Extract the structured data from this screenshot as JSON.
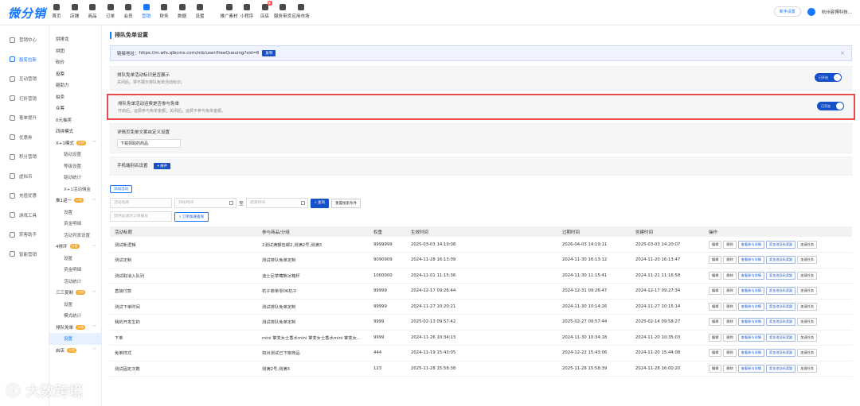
{
  "brand": {
    "logo": "微分销",
    "accent": "#1677ff",
    "dark_blue": "#1650c8",
    "highlight_border": "#e74c4c"
  },
  "topnav": [
    {
      "label": "首页",
      "icon": "home-icon"
    },
    {
      "label": "店铺",
      "icon": "store-icon"
    },
    {
      "label": "商品",
      "icon": "goods-icon"
    },
    {
      "label": "订单",
      "icon": "order-icon"
    },
    {
      "label": "会员",
      "icon": "member-icon"
    },
    {
      "label": "营销",
      "icon": "marketing-icon",
      "active": true
    },
    {
      "label": "财务",
      "icon": "finance-icon"
    },
    {
      "label": "数据",
      "icon": "data-icon"
    },
    {
      "label": "设置",
      "icon": "settings-icon"
    },
    {
      "label": "推广素材",
      "icon": "share-icon"
    },
    {
      "label": "小程序",
      "icon": "miniapp-icon"
    },
    {
      "label": "店店",
      "icon": "shop-icon",
      "tag": "新"
    },
    {
      "label": "服务带货",
      "icon": "service-icon"
    },
    {
      "label": "应用市场",
      "icon": "app-market-icon"
    }
  ],
  "top_right": {
    "pill": "新手设置",
    "company": "杭州容博科技..."
  },
  "sidebar1": [
    {
      "label": "营销中心"
    },
    {
      "label": "裂变拉新",
      "active": true
    },
    {
      "label": "互动营销"
    },
    {
      "label": "打折营销"
    },
    {
      "label": "客单提升"
    },
    {
      "label": "优惠券"
    },
    {
      "label": "积分营销"
    },
    {
      "label": "虚拟币"
    },
    {
      "label": "充值优惠"
    },
    {
      "label": "游戏工具"
    },
    {
      "label": "获客助手"
    },
    {
      "label": "智能营销"
    }
  ],
  "sidebar2": [
    {
      "label": "拼排龙"
    },
    {
      "label": "拼团"
    },
    {
      "label": "砍价"
    },
    {
      "label": "投票"
    },
    {
      "label": "砸助力"
    },
    {
      "label": "拍卖"
    },
    {
      "label": "众筹"
    },
    {
      "label": "0元抽奖"
    },
    {
      "label": "四拼模式"
    },
    {
      "label": "X+1模式",
      "badge": "分销",
      "chev": "﹀"
    },
    {
      "label": "链动设置",
      "sub": true
    },
    {
      "label": "等级设置",
      "sub": true
    },
    {
      "label": "链动统计",
      "sub": true
    },
    {
      "label": "X+1活动佣金",
      "sub": true
    },
    {
      "label": "推1返一",
      "badge": "分销",
      "chev": "﹀"
    },
    {
      "label": "设置",
      "sub": true
    },
    {
      "label": "资金明细",
      "sub": true
    },
    {
      "label": "活动列表设置",
      "sub": true
    },
    {
      "label": "4排环",
      "badge": "分销",
      "chev": "﹀"
    },
    {
      "label": "设置",
      "sub": true
    },
    {
      "label": "资金明细",
      "sub": true
    },
    {
      "label": "活动统计",
      "sub": true
    },
    {
      "label": "三三复制",
      "badge": "分销",
      "chev": "﹀"
    },
    {
      "label": "设置",
      "sub": true
    },
    {
      "label": "模式统计",
      "sub": true
    },
    {
      "label": "排队免单",
      "badge": "分销",
      "chev": "﹀"
    },
    {
      "label": "设置",
      "sub": true,
      "active": true
    },
    {
      "label": "启店",
      "badge": "分销",
      "chev": "﹀"
    }
  ],
  "main": {
    "title": "排队免单设置",
    "link_label": "链接地址：",
    "link_url": "https://m.wfx.qlbcms.com/mb/user/freeQueuing?sid=6",
    "copy_btn": "复制",
    "panels": [
      {
        "title": "排队免单活动标识是否展示",
        "desc": "关闭后，将不展示排队免单活动标识。",
        "toggle": "已开启"
      },
      {
        "title": "排队免单活动运费是否参与免单",
        "desc": "开启后，运费参与免单金额；关闭后，运费不参与免单金额。",
        "toggle": "已开启"
      }
    ],
    "custom_title": "详情页免单文案自定义设置",
    "custom_value": "下载领取的商品",
    "alias_title": "手机端别名设置",
    "alias_btn": "展开"
  },
  "filters": {
    "add_btn": "添加活动",
    "name_ph": "活动名称",
    "start_ph": "开始时间",
    "to": "至",
    "end_ph": "结束时间",
    "query_btn": "查询",
    "reset_btn": "重置搜索条件",
    "order_ph": "提供加速的订单编号",
    "order_btn": "订单加速查询"
  },
  "table": {
    "headers": [
      "活动标题",
      "参与商品/分组",
      "权重",
      "生效时间",
      "过期时间",
      "创建时间",
      "操作"
    ],
    "actions": [
      "编辑",
      "删除",
      "查看参与详情",
      "奖金池及码奖励",
      "加速任务"
    ],
    "rows": [
      {
        "title": "测试新逻辑",
        "goods": "2测试满额包邮2,测满2号,测满3",
        "weight": "9999999",
        "start": "2025-03-03 14:19:08",
        "end": "2026-04-03 14:19:11",
        "created": "2025-03-03 14:20:07"
      },
      {
        "title": "测试定制",
        "goods": "测试排队免单定制",
        "weight": "9090909",
        "start": "2024-11-28 16:13:09",
        "end": "2024-11-30 16:13:12",
        "created": "2024-11-20 16:13:47"
      },
      {
        "title": "测试取消入队列",
        "goods": "迪士尼草莓熊冰箱杯",
        "weight": "1000000",
        "start": "2024-11-01 11:15:36",
        "end": "2024-11-30 11:15:41",
        "created": "2024-11-21 11:16:58"
      },
      {
        "title": "直接付款",
        "goods": "杭子菲单零06杭子",
        "weight": "99999",
        "start": "2024-12-17 09:26:44",
        "end": "2024-12-31 09:26:47",
        "created": "2024-12-17 09:27:34"
      },
      {
        "title": "测试下单时间",
        "goods": "测试排队免单定制",
        "weight": "99999",
        "start": "2024-11-27 10:20:21",
        "end": "2024-11-30 10:14:26",
        "created": "2024-11-27 10:15:14"
      },
      {
        "title": "我的开发生的",
        "goods": "测试排队免单定制",
        "weight": "9999",
        "start": "2025-02-13 09:57:42",
        "end": "2025-02-27 09:57:44",
        "created": "2025-02-14 09:58:27"
      },
      {
        "title": "下单",
        "goods": "mini 掌变女士香水mini 掌变女士香水mini 掌变女...",
        "weight": "9999",
        "start": "2024-11-26 10:34:13",
        "end": "2024-11-30 10:34:18",
        "created": "2024-11-20 10:35:03"
      },
      {
        "title": "免单样式",
        "goods": "如对测试已下架商品",
        "weight": "444",
        "start": "2024-11-19 15:43:05",
        "end": "2024-12-22 15:43:06",
        "created": "2024-11-20 15:44:08"
      },
      {
        "title": "测试固定次数",
        "goods": "测满2号,测满3",
        "weight": "123",
        "start": "2025-11-28 15:58:38",
        "end": "2025-11-28 15:58:39",
        "created": "2024-11-28 16:00:20"
      }
    ]
  },
  "watermark": "大数跨境"
}
